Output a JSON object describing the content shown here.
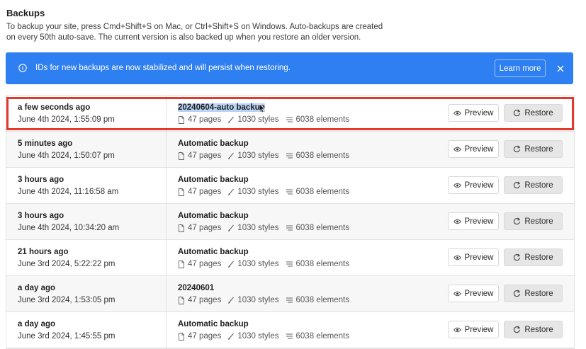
{
  "header": {
    "title": "Backups",
    "description": "To backup your site, press Cmd+Shift+S on Mac, or Ctrl+Shift+S on Windows. Auto-backups are created on every 50th auto-save. The current version is also backed up when you restore an older version."
  },
  "banner": {
    "text": "IDs for new backups are now stabilized and will persist when restoring.",
    "learn_more_label": "Learn more",
    "close_icon": "close-icon",
    "info_icon": "info-icon",
    "color": "#2e7ff1"
  },
  "actions": {
    "preview_label": "Preview",
    "restore_label": "Restore"
  },
  "highlight_color": "#e5382c",
  "backups": [
    {
      "relative": "a few seconds ago",
      "timestamp": "June 4th 2024, 1:55:09 pm",
      "name": "20240604-auto backup",
      "pages": "47 pages",
      "styles": "1030 styles",
      "elements": "6038 elements"
    },
    {
      "relative": "5 minutes ago",
      "timestamp": "June 4th 2024, 1:50:07 pm",
      "name": "Automatic backup",
      "pages": "47 pages",
      "styles": "1030 styles",
      "elements": "6038 elements"
    },
    {
      "relative": "3 hours ago",
      "timestamp": "June 4th 2024, 11:16:58 am",
      "name": "Automatic backup",
      "pages": "47 pages",
      "styles": "1030 styles",
      "elements": "6038 elements"
    },
    {
      "relative": "3 hours ago",
      "timestamp": "June 4th 2024, 10:34:20 am",
      "name": "Automatic backup",
      "pages": "47 pages",
      "styles": "1030 styles",
      "elements": "6038 elements"
    },
    {
      "relative": "21 hours ago",
      "timestamp": "June 3rd 2024, 5:22:22 pm",
      "name": "Automatic backup",
      "pages": "47 pages",
      "styles": "1030 styles",
      "elements": "6038 elements"
    },
    {
      "relative": "a day ago",
      "timestamp": "June 3rd 2024, 1:53:05 pm",
      "name": "20240601",
      "pages": "47 pages",
      "styles": "1030 styles",
      "elements": "6038 elements"
    },
    {
      "relative": "a day ago",
      "timestamp": "June 3rd 2024, 1:45:55 pm",
      "name": "Automatic backup",
      "pages": "47 pages",
      "styles": "1030 styles",
      "elements": "6038 elements"
    }
  ]
}
